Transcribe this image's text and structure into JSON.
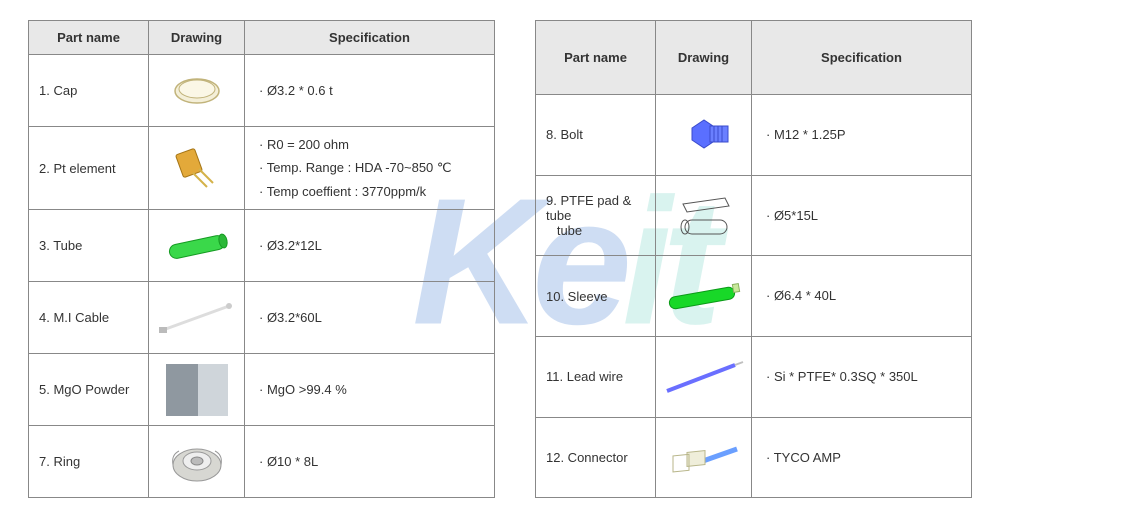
{
  "headers": {
    "name": "Part name",
    "drawing": "Drawing",
    "spec": "Specification"
  },
  "left": [
    {
      "name": "1. Cap",
      "icon": "cap-icon",
      "spec": [
        "· Ø3.2 * 0.6 t"
      ]
    },
    {
      "name": "2. Pt element",
      "icon": "pt-icon",
      "spec": [
        "· R0 = 200 ohm",
        "· Temp. Range : HDA -70~850 ℃",
        "· Temp coeffient : 3770ppm/k"
      ]
    },
    {
      "name": "3. Tube",
      "icon": "tube-icon",
      "spec": [
        "· Ø3.2*12L"
      ]
    },
    {
      "name": "4. M.I Cable",
      "icon": "cable-icon",
      "spec": [
        "· Ø3.2*60L"
      ]
    },
    {
      "name": "5. MgO Powder",
      "icon": "powder-icon",
      "spec": [
        "· MgO >99.4 %"
      ]
    },
    {
      "name": "7. Ring",
      "icon": "ring-icon",
      "spec": [
        "· Ø10 * 8L"
      ]
    }
  ],
  "right": [
    {
      "name": "8. Bolt",
      "icon": "bolt-icon",
      "spec": [
        "· M12 * 1.25P"
      ]
    },
    {
      "name": "9. PTFE pad & tube",
      "name2": "tube",
      "icon": "ptfe-icon",
      "spec": [
        "· Ø5*15L"
      ]
    },
    {
      "name": "10. Sleeve",
      "icon": "sleeve-icon",
      "spec": [
        "· Ø6.4 * 40L"
      ]
    },
    {
      "name": "11. Lead wire",
      "icon": "wire-icon",
      "spec": [
        "· Si * PTFE* 0.3SQ * 350L"
      ]
    },
    {
      "name": "12. Connector",
      "icon": "conn-icon",
      "spec": [
        "· TYCO AMP"
      ]
    }
  ]
}
